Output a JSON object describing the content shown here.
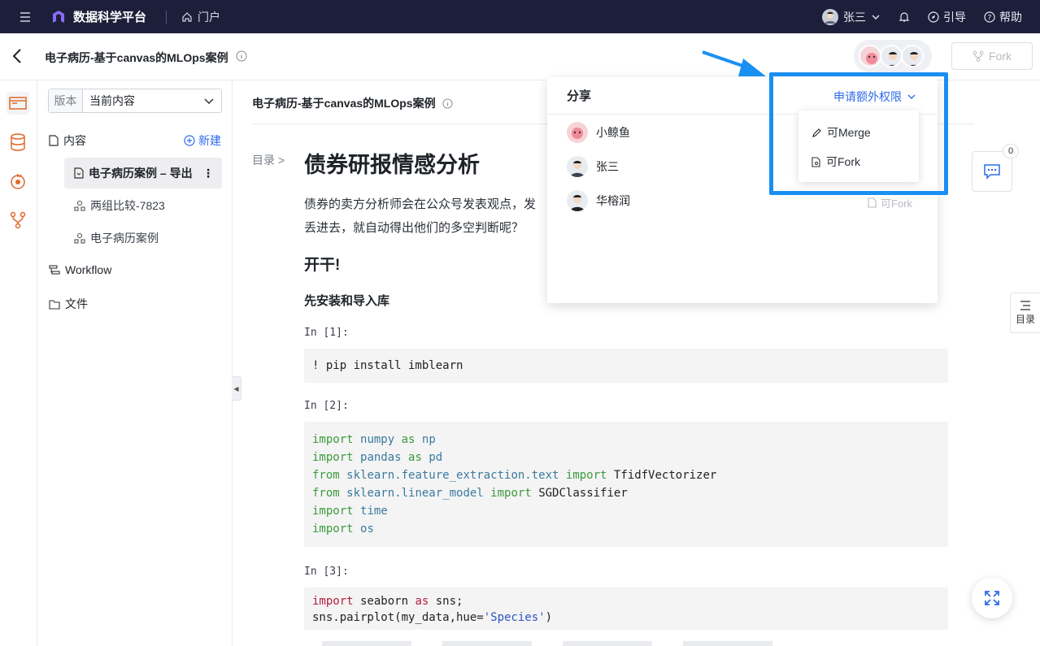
{
  "topnav": {
    "app_name": "数据科学平台",
    "portal": "门户",
    "user": "张三",
    "guide": "引导",
    "help": "帮助"
  },
  "header": {
    "title": "电子病历-基于canvas的MLOps案例",
    "fork_label": "Fork"
  },
  "sidebar": {
    "version_label": "版本",
    "version_value": "当前内容",
    "content_label": "内容",
    "new_label": "新建",
    "items": [
      {
        "label": "电子病历案例 – 导出",
        "active": true
      },
      {
        "label": "两组比较-7823",
        "active": false
      },
      {
        "label": "电子病历案例",
        "active": false
      }
    ],
    "workflow_label": "Workflow",
    "files_label": "文件"
  },
  "main": {
    "doc_title": "电子病历-基于canvas的MLOps案例",
    "toc_link": "目录 >",
    "heading1": "债券研报情感分析",
    "para_line1": "债券的卖方分析师会在公众号发表观点，发",
    "para_line2": "丢进去，就自动得出他们的多空判断呢？",
    "heading2": "开干!",
    "heading3": "先安装和导入库",
    "cells": [
      {
        "label": "In [1]:"
      },
      {
        "label": "In [2]:"
      },
      {
        "label": "In [3]:"
      }
    ],
    "code1": "! pip install imblearn",
    "code2": [
      {
        "k": "import",
        "m": "numpy",
        "a": "as",
        "n": "np"
      },
      {
        "k": "import",
        "m": "pandas",
        "a": "as",
        "n": "pd"
      },
      {
        "k": "from",
        "m": "sklearn.feature_extraction.text",
        "a": "import",
        "n": "TfidfVectorizer"
      },
      {
        "k": "from",
        "m": "sklearn.linear_model",
        "a": "import",
        "n": "SGDClassifier"
      },
      {
        "k": "import",
        "m": "time",
        "a": "",
        "n": ""
      },
      {
        "k": "import",
        "m": "os",
        "a": "",
        "n": ""
      }
    ],
    "code3": {
      "line1_kw": "import",
      "line1_rest": " seaborn ",
      "line1_as": "as",
      "line1_end": " sns;",
      "line2_pre": "sns.pairplot(my_data,hue=",
      "line2_str": "'Species'",
      "line2_end": ")"
    }
  },
  "share": {
    "title": "分享",
    "request_label": "申请额外权限",
    "members": [
      {
        "name": "小鲸鱼"
      },
      {
        "name": "张三"
      },
      {
        "name": "华榕润"
      }
    ],
    "member_perm": "可Fork",
    "options": [
      "可Merge",
      "可Fork"
    ]
  },
  "floaters": {
    "chat_count": "0",
    "toc_label": "目录"
  },
  "colors": {
    "topnav_bg": "#1d1f3a",
    "accent": "#2f6bea",
    "highlight": "#1a8ff2"
  }
}
